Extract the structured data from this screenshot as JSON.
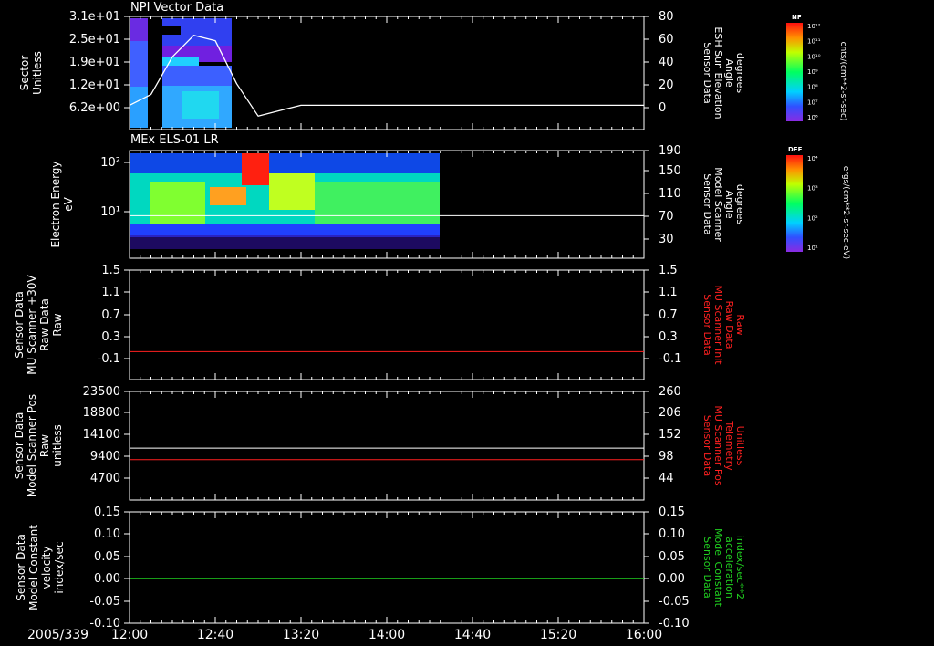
{
  "colors": {
    "background": "#000000",
    "axis": "#ffffff",
    "red": "#ff2020",
    "green": "#20d020"
  },
  "footer": {
    "date_label": "2005/339"
  },
  "x_axis": {
    "ticks": [
      "12:00",
      "12:40",
      "13:20",
      "14:00",
      "14:40",
      "15:20",
      "16:00"
    ]
  },
  "chart_data": [
    {
      "type": "heatmap",
      "title": "NPI Vector Data",
      "ylabel_left": "Sector\nUnitless",
      "ylabel_right": "Sensor Data\nESH Sun Elevation\nAngle\ndegrees",
      "yticks_left": [
        "3.1e+01",
        "2.5e+01",
        "1.9e+01",
        "1.2e+01",
        "6.2e+00"
      ],
      "yticks_right": [
        "80",
        "60",
        "40",
        "20",
        "0"
      ],
      "colorbar": {
        "label": "NF",
        "unit_label": "cnts/(cm**2-sr-sec)",
        "ticks": [
          "10¹²",
          "10¹¹",
          "10¹⁰",
          "10⁹",
          "10⁸",
          "10⁷",
          "10⁶"
        ]
      },
      "line_series": {
        "name": "Sensor Data ESH Sun Elevation Angle",
        "x": [
          "12:00",
          "12:10",
          "12:20",
          "12:30",
          "12:40",
          "12:50",
          "13:00",
          "13:10",
          "13:20",
          "16:00"
        ],
        "y": [
          0,
          10,
          45,
          65,
          60,
          20,
          -10,
          -5,
          0,
          0
        ]
      }
    },
    {
      "type": "heatmap",
      "title": "MEx ELS-01 LR",
      "ylabel_left": "Electron Energy\neV",
      "ylabel_right": "Sensor Data\nModel Scanner\nAngle\ndegrees",
      "yticks_left": [
        "10²",
        "10¹"
      ],
      "yticks_right": [
        "190",
        "150",
        "110",
        "70",
        "30"
      ],
      "colorbar": {
        "label": "DEF",
        "unit_label": "ergs/(cm**2-sr-sec-eV)",
        "ticks": [
          "10⁴",
          "10³",
          "10²",
          "10¹"
        ]
      },
      "line_series": {
        "name": "Sensor Data Model Scanner Angle",
        "x": [
          "12:00",
          "16:00"
        ],
        "y": [
          90,
          90
        ]
      }
    },
    {
      "type": "line",
      "ylabel_left": "Sensor Data\nMU Scanner +30V\nRaw Data\nRaw",
      "ylabel_right": "Sensor Data\nMU Scanner Init\nRaw Data\nRaw",
      "yticks_left": [
        "1.5",
        "1.1",
        "0.7",
        "0.3",
        "-0.1"
      ],
      "yticks_right": [
        "1.5",
        "1.1",
        "0.7",
        "0.3",
        "-0.1"
      ],
      "series": [
        {
          "name": "Sensor Data MU Scanner Init Raw Data",
          "x": [
            "12:00",
            "16:00"
          ],
          "y": [
            0,
            0
          ]
        }
      ]
    },
    {
      "type": "line",
      "ylabel_left": "Sensor Data\nModel Scanner Pos\nRaw\nunitless",
      "ylabel_right": "Sensor Data\nMU Scanner Pos\nTelemetry\nUnitless",
      "yticks_left": [
        "23500",
        "18800",
        "14100",
        "9400",
        "4700"
      ],
      "yticks_right": [
        "260",
        "206",
        "152",
        "98",
        "44"
      ],
      "series": [
        {
          "name": "Sensor Data Model Scanner Pos Raw",
          "x": [
            "12:00",
            "16:00"
          ],
          "y": [
            11200,
            11200
          ]
        },
        {
          "name": "Sensor Data MU Scanner Pos Telemetry",
          "x": [
            "12:00",
            "16:00"
          ],
          "y": [
            90,
            90
          ]
        }
      ]
    },
    {
      "type": "line",
      "ylabel_left": "Sensor Data\nModel Constant\nvelocity\nindex/sec",
      "ylabel_right": "Sensor Data\nModel Constant\nacceleration\nindex/sec**2",
      "yticks_left": [
        "0.15",
        "0.10",
        "0.05",
        "0.00",
        "-0.05",
        "-0.10"
      ],
      "yticks_right": [
        "0.15",
        "0.10",
        "0.05",
        "0.00",
        "-0.05",
        "-0.10"
      ],
      "series": [
        {
          "name": "Sensor Data Model Constant acceleration",
          "x": [
            "12:00",
            "16:00"
          ],
          "y": [
            0,
            0
          ]
        }
      ]
    }
  ]
}
